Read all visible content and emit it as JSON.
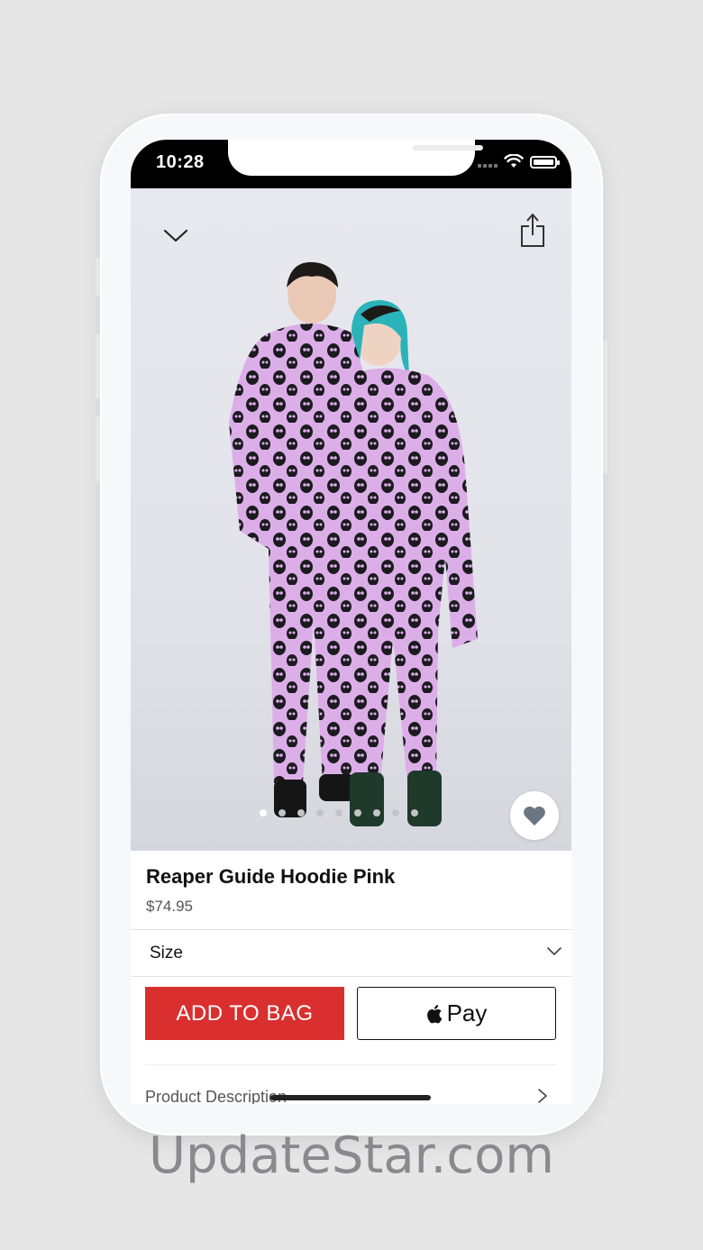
{
  "status_bar": {
    "time": "10:28"
  },
  "product": {
    "name": "Reaper Guide Hoodie Pink",
    "price": "$74.95",
    "image_description_icon": "product-photo",
    "carousel": {
      "total": 9,
      "active_index": 0
    },
    "favorite_icon": "heart-icon"
  },
  "size_selector": {
    "label": "Size"
  },
  "actions": {
    "add_to_bag": "ADD TO BAG",
    "apple_pay": "Pay"
  },
  "description_row": {
    "label": "Product Description"
  },
  "watermark": "UpdateStar.com",
  "colors": {
    "accent_red": "#d9302f",
    "hoodie_pink": "#dcaee8",
    "background": "#e6e6e7"
  }
}
